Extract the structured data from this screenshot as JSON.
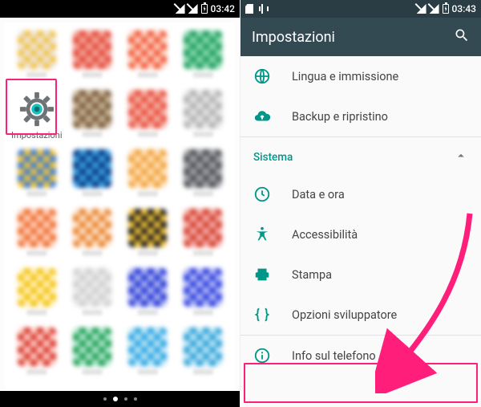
{
  "left": {
    "status": {
      "time": "03:42"
    },
    "apps": {
      "settings_label": "Impostazioni"
    }
  },
  "right": {
    "status": {
      "time": "03:43"
    },
    "appbar": {
      "title": "Impostazioni"
    },
    "items": {
      "language": "Lingua e immissione",
      "backup": "Backup e ripristino",
      "section": "Sistema",
      "datetime": "Data e ora",
      "a11y": "Accessibilità",
      "print": "Stampa",
      "dev": "Opzioni sviluppatore",
      "about": "Info sul telefono"
    }
  },
  "colors": {
    "accent": "#009688",
    "highlight": "#ff1e7a"
  }
}
